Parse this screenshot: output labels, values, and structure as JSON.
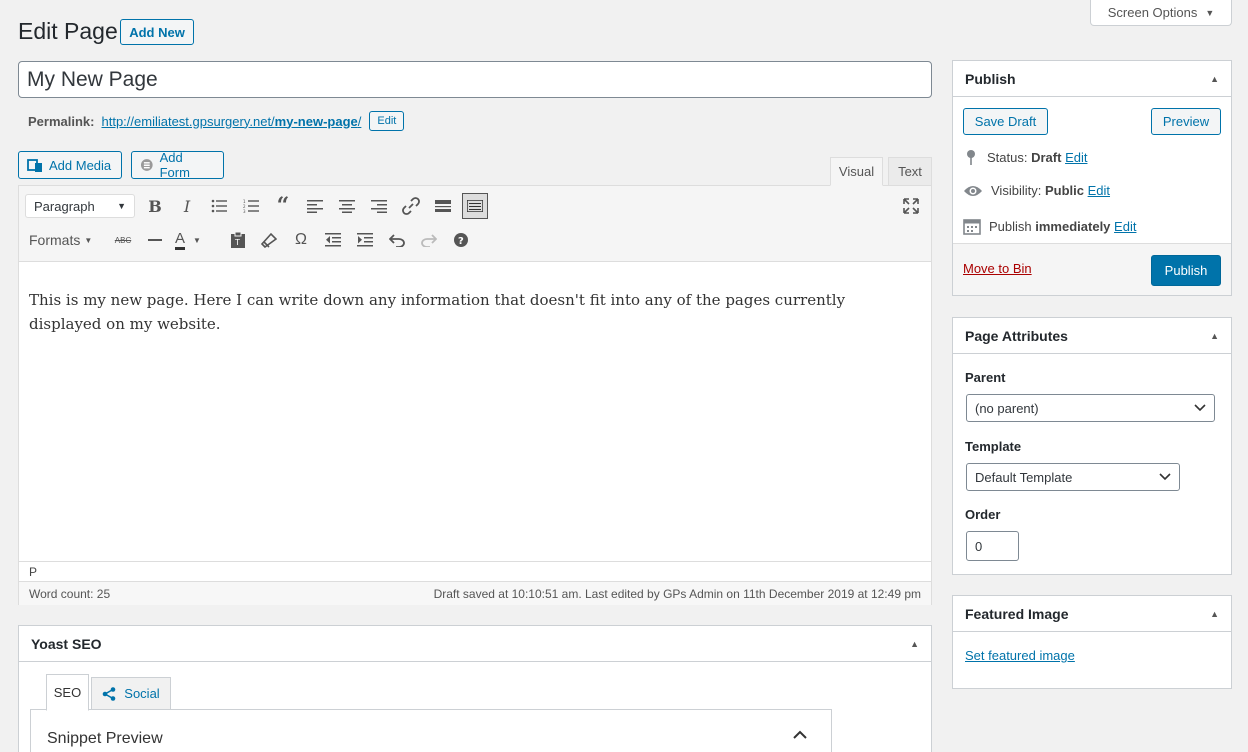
{
  "header": {
    "title": "Edit Page",
    "add_new": "Add New",
    "screen_options": "Screen Options"
  },
  "post": {
    "title": "My New Page",
    "permalink_label": "Permalink:",
    "permalink_base": "http://emiliatest.gpsurgery.net/",
    "permalink_slug": "my-new-page",
    "permalink_tail": "/",
    "permalink_edit": "Edit"
  },
  "media": {
    "add_media": "Add Media",
    "add_form": "Add Form"
  },
  "editor": {
    "tab_visual": "Visual",
    "tab_text": "Text",
    "format_select": "Paragraph",
    "formats_menu": "Formats",
    "content": "This is my new page. Here I can write down any information that doesn't fit into any of the pages currently displayed on my website.",
    "path": "P",
    "word_count": "Word count: 25",
    "draft_status": "Draft saved at 10:10:51 am. Last edited by GPs Admin on 11th December 2019 at 12:49 pm"
  },
  "publish": {
    "title": "Publish",
    "save_draft": "Save Draft",
    "preview": "Preview",
    "status_label": "Status:",
    "status_value": "Draft",
    "visibility_label": "Visibility:",
    "visibility_value": "Public",
    "publish_label": "Publish",
    "publish_value": "immediately",
    "edit": "Edit",
    "move_to_bin": "Move to Bin",
    "publish_button": "Publish"
  },
  "attributes": {
    "title": "Page Attributes",
    "parent_label": "Parent",
    "parent_value": "(no parent)",
    "template_label": "Template",
    "template_value": "Default Template",
    "order_label": "Order",
    "order_value": "0"
  },
  "featured": {
    "title": "Featured Image",
    "set_link": "Set featured image"
  },
  "yoast": {
    "title": "Yoast SEO",
    "tab_seo": "SEO",
    "tab_social": "Social",
    "snippet_preview": "Snippet Preview"
  },
  "colors": {
    "accent": "#0073aa",
    "danger": "#a00"
  }
}
